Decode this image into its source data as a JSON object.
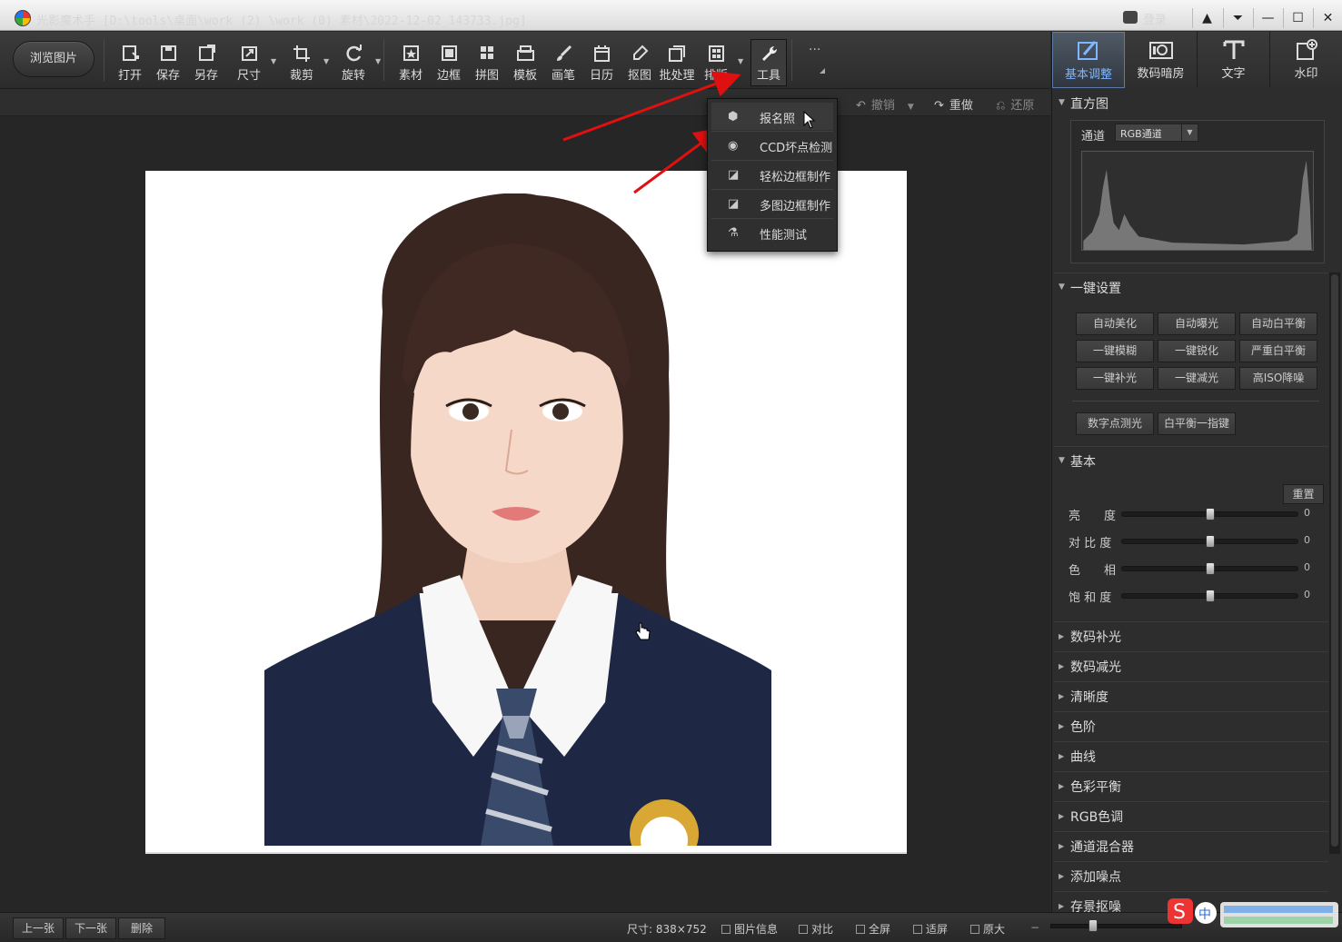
{
  "window": {
    "title": "光影魔术手  [D:\\tools\\桌面\\work (2) \\work (0) 素材\\2022-12-02_143733.jpg]",
    "login_label": "登录",
    "controls": [
      "▲",
      "⏷",
      "—",
      "☐",
      "✕"
    ]
  },
  "toolbar": {
    "browse_label": "浏览图片",
    "tools": [
      {
        "label": "打开",
        "icon": "open-icon"
      },
      {
        "label": "保存",
        "icon": "save-icon"
      },
      {
        "label": "另存",
        "icon": "save-as-icon"
      },
      {
        "label": "尺寸",
        "icon": "resize-icon"
      },
      {
        "label": "裁剪",
        "icon": "crop-icon"
      },
      {
        "label": "旋转",
        "icon": "rotate-icon"
      },
      {
        "label": "素材",
        "icon": "material-icon"
      },
      {
        "label": "边框",
        "icon": "border-icon"
      },
      {
        "label": "拼图",
        "icon": "collage-icon"
      },
      {
        "label": "模板",
        "icon": "template-icon"
      },
      {
        "label": "画笔",
        "icon": "brush-icon"
      },
      {
        "label": "日历",
        "icon": "calendar-icon"
      },
      {
        "label": "抠图",
        "icon": "cutout-icon"
      },
      {
        "label": "批处理",
        "icon": "batch-icon"
      },
      {
        "label": "排版",
        "icon": "layout-icon"
      },
      {
        "label": "工具",
        "icon": "wrench-icon"
      }
    ],
    "more_label": "···"
  },
  "subbar": {
    "undo_label": "撤销",
    "redo_label": "重做",
    "restore_label": "还原"
  },
  "dropdown": {
    "items": [
      {
        "label": "报名照",
        "icon": "id-photo-icon"
      },
      {
        "label": "CCD坏点检测",
        "icon": "ccd-check-icon"
      },
      {
        "label": "轻松边框制作",
        "icon": "easy-border-icon"
      },
      {
        "label": "多图边框制作",
        "icon": "multi-border-icon"
      },
      {
        "label": "性能测试",
        "icon": "performance-icon"
      }
    ]
  },
  "right_panel": {
    "tabs": [
      {
        "label": "基本调整",
        "icon": "basic-adjust-icon",
        "active": true
      },
      {
        "label": "数码暗房",
        "icon": "darkroom-icon",
        "active": false
      },
      {
        "label": "文字",
        "icon": "text-icon",
        "active": false
      },
      {
        "label": "水印",
        "icon": "watermark-icon",
        "active": false
      }
    ],
    "histogram": {
      "title": "直方图",
      "channel_label": "通道",
      "channel_value": "RGB通道"
    },
    "onekey": {
      "title": "一键设置",
      "buttons": [
        "自动美化",
        "自动曝光",
        "自动白平衡",
        "一键模糊",
        "一键锐化",
        "严重白平衡",
        "一键补光",
        "一键减光",
        "高ISO降噪"
      ],
      "buttons2": [
        "数字点测光",
        "白平衡一指键"
      ]
    },
    "basic": {
      "title": "基本",
      "reset_label": "重置",
      "sliders": [
        {
          "label": "亮　　度",
          "value": "0",
          "level": 0.5
        },
        {
          "label": "对 比 度",
          "value": "0",
          "level": 0.5
        },
        {
          "label": "色　　相",
          "value": "0",
          "level": 0.5
        },
        {
          "label": "饱 和 度",
          "value": "0",
          "level": 0.5
        }
      ]
    },
    "collapsed_sections": [
      "数码补光",
      "数码减光",
      "清晰度",
      "色阶",
      "曲线",
      "色彩平衡",
      "RGB色调",
      "通道混合器",
      "添加噪点",
      "存景抠噪"
    ]
  },
  "statusbar": {
    "prev_label": "上一张",
    "next_label": "下一张",
    "delete_label": "删除",
    "size_text": "尺寸: 838×752",
    "info_label": "图片信息",
    "compare_label": "对比",
    "fullscreen_label": "全屏",
    "fit_label": "适屏",
    "original_label": "原大"
  },
  "colors": {
    "accent_blue": "#7fb6ff",
    "arrow_red": "#e01010"
  }
}
